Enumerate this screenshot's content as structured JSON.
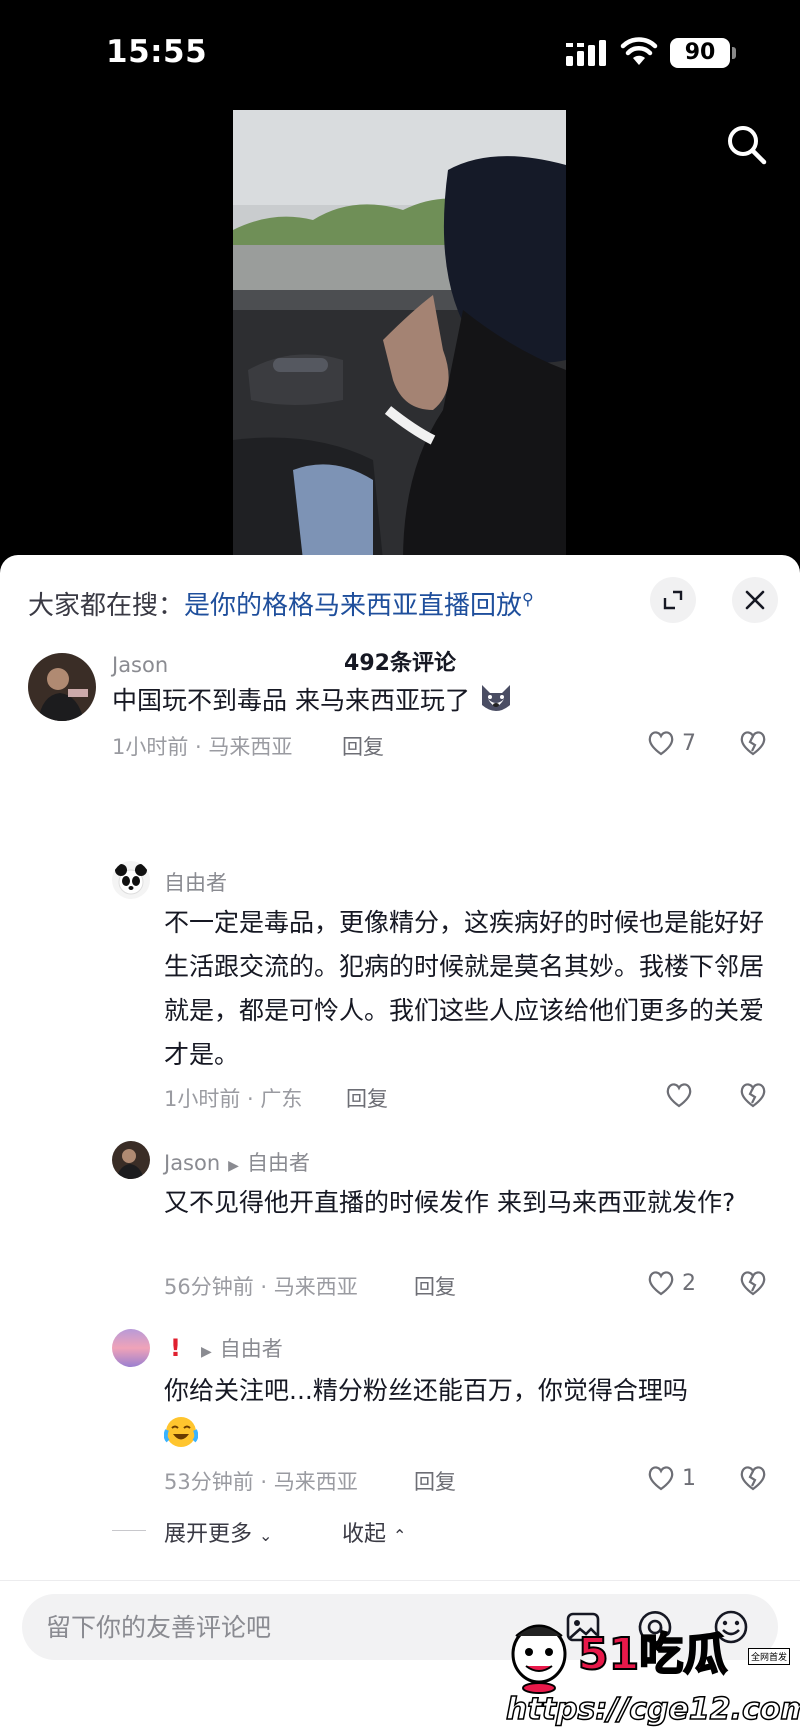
{
  "status_bar": {
    "time": "15:55",
    "battery": "90"
  },
  "search_hint": {
    "prefix": "大家都在搜：",
    "keyword": "是你的格格马来西亚直播回放"
  },
  "comment_count": "492条评论",
  "comments": [
    {
      "username": "Jason",
      "text": "中国玩不到毒品 来马来西亚玩了",
      "emoji": "husky-dog-emoji",
      "meta": "1小时前 · 马来西亚",
      "reply": "回复",
      "likes": "7"
    },
    {
      "username": "自由者",
      "text": "不一定是毒品，更像精分，这疾病好的时候也是能好好生活跟交流的。犯病的时候就是莫名其妙。我楼下邻居就是，都是可怜人。我们这些人应该给他们更多的关爱才是。",
      "meta": "1小时前 · 广东",
      "reply": "回复",
      "likes": ""
    },
    {
      "username": "Jason",
      "reply_to": "自由者",
      "text": "又不见得他开直播的时候发作 来到马来西亚就发作?",
      "meta": "56分钟前 · 马来西亚",
      "reply": "回复",
      "likes": "2"
    },
    {
      "username": "!",
      "reply_to": "自由者",
      "text": "你给关注吧...精分粉丝还能百万，你觉得合理吗",
      "emoji": "crying-laughing-emoji",
      "meta": "53分钟前 · 马来西亚",
      "reply": "回复",
      "likes": "1"
    }
  ],
  "thread_actions": {
    "expand_more": "展开更多",
    "collapse": "收起"
  },
  "input": {
    "placeholder": "留下你的友善评论吧"
  },
  "watermark": {
    "title": "51吃瓜",
    "badge": "全网首发",
    "url": "https://cge12.com"
  }
}
